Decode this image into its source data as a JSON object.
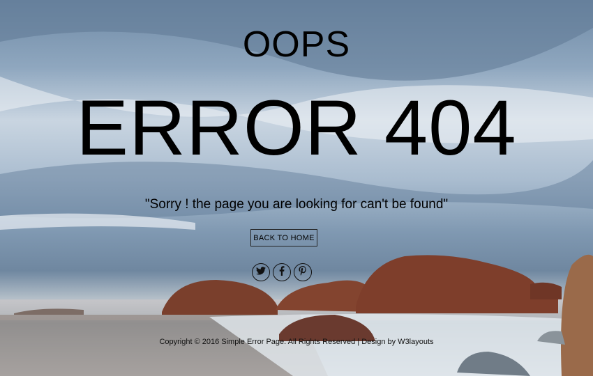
{
  "heading": "OOPS",
  "title": "ERROR 404",
  "message": "\"Sorry ! the page you are looking for can't be found\"",
  "home_button": "BACK TO HOME",
  "socials": [
    {
      "icon": "twitter-icon"
    },
    {
      "icon": "facebook-icon"
    },
    {
      "icon": "pinterest-icon"
    }
  ],
  "footer": "Copyright © 2016 Simple Error Page. All Rights Reserved | Design by W3layouts"
}
